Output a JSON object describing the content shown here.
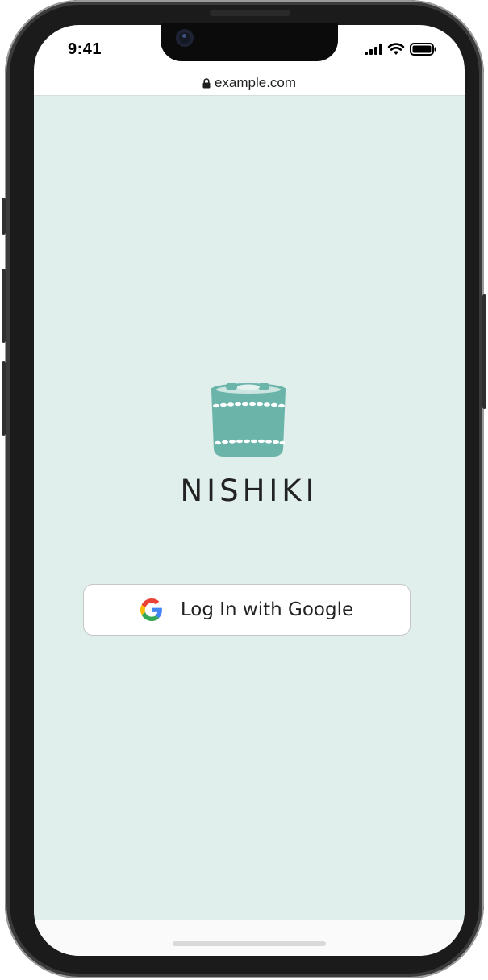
{
  "status_bar": {
    "time": "9:41",
    "icons": [
      "cellular-signal-icon",
      "wifi-icon",
      "battery-icon"
    ]
  },
  "browser": {
    "url": "example.com",
    "lock_icon": "lock-icon"
  },
  "app": {
    "brand_name": "NISHIKI",
    "logo_icon": "sushi-tub-icon",
    "login_button": {
      "label": "Log In with Google",
      "icon": "google-g-icon"
    }
  },
  "colors": {
    "background": "#e0efeb",
    "logo_teal": "#6ab4aa",
    "text": "#222222"
  }
}
